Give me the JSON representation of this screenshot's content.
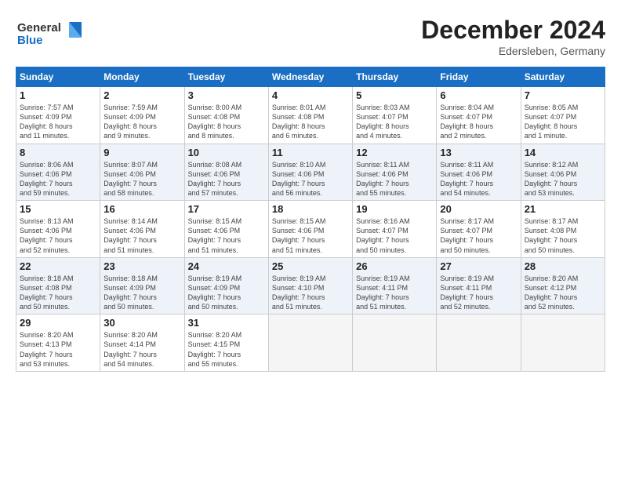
{
  "header": {
    "logo_line1": "General",
    "logo_line2": "Blue",
    "month_title": "December 2024",
    "location": "Edersleben, Germany"
  },
  "days_of_week": [
    "Sunday",
    "Monday",
    "Tuesday",
    "Wednesday",
    "Thursday",
    "Friday",
    "Saturday"
  ],
  "weeks": [
    {
      "row_alt": false,
      "days": [
        {
          "num": "1",
          "lines": [
            "Sunrise: 7:57 AM",
            "Sunset: 4:09 PM",
            "Daylight: 8 hours",
            "and 11 minutes."
          ]
        },
        {
          "num": "2",
          "lines": [
            "Sunrise: 7:59 AM",
            "Sunset: 4:09 PM",
            "Daylight: 8 hours",
            "and 9 minutes."
          ]
        },
        {
          "num": "3",
          "lines": [
            "Sunrise: 8:00 AM",
            "Sunset: 4:08 PM",
            "Daylight: 8 hours",
            "and 8 minutes."
          ]
        },
        {
          "num": "4",
          "lines": [
            "Sunrise: 8:01 AM",
            "Sunset: 4:08 PM",
            "Daylight: 8 hours",
            "and 6 minutes."
          ]
        },
        {
          "num": "5",
          "lines": [
            "Sunrise: 8:03 AM",
            "Sunset: 4:07 PM",
            "Daylight: 8 hours",
            "and 4 minutes."
          ]
        },
        {
          "num": "6",
          "lines": [
            "Sunrise: 8:04 AM",
            "Sunset: 4:07 PM",
            "Daylight: 8 hours",
            "and 2 minutes."
          ]
        },
        {
          "num": "7",
          "lines": [
            "Sunrise: 8:05 AM",
            "Sunset: 4:07 PM",
            "Daylight: 8 hours",
            "and 1 minute."
          ]
        }
      ]
    },
    {
      "row_alt": true,
      "days": [
        {
          "num": "8",
          "lines": [
            "Sunrise: 8:06 AM",
            "Sunset: 4:06 PM",
            "Daylight: 7 hours",
            "and 59 minutes."
          ]
        },
        {
          "num": "9",
          "lines": [
            "Sunrise: 8:07 AM",
            "Sunset: 4:06 PM",
            "Daylight: 7 hours",
            "and 58 minutes."
          ]
        },
        {
          "num": "10",
          "lines": [
            "Sunrise: 8:08 AM",
            "Sunset: 4:06 PM",
            "Daylight: 7 hours",
            "and 57 minutes."
          ]
        },
        {
          "num": "11",
          "lines": [
            "Sunrise: 8:10 AM",
            "Sunset: 4:06 PM",
            "Daylight: 7 hours",
            "and 56 minutes."
          ]
        },
        {
          "num": "12",
          "lines": [
            "Sunrise: 8:11 AM",
            "Sunset: 4:06 PM",
            "Daylight: 7 hours",
            "and 55 minutes."
          ]
        },
        {
          "num": "13",
          "lines": [
            "Sunrise: 8:11 AM",
            "Sunset: 4:06 PM",
            "Daylight: 7 hours",
            "and 54 minutes."
          ]
        },
        {
          "num": "14",
          "lines": [
            "Sunrise: 8:12 AM",
            "Sunset: 4:06 PM",
            "Daylight: 7 hours",
            "and 53 minutes."
          ]
        }
      ]
    },
    {
      "row_alt": false,
      "days": [
        {
          "num": "15",
          "lines": [
            "Sunrise: 8:13 AM",
            "Sunset: 4:06 PM",
            "Daylight: 7 hours",
            "and 52 minutes."
          ]
        },
        {
          "num": "16",
          "lines": [
            "Sunrise: 8:14 AM",
            "Sunset: 4:06 PM",
            "Daylight: 7 hours",
            "and 51 minutes."
          ]
        },
        {
          "num": "17",
          "lines": [
            "Sunrise: 8:15 AM",
            "Sunset: 4:06 PM",
            "Daylight: 7 hours",
            "and 51 minutes."
          ]
        },
        {
          "num": "18",
          "lines": [
            "Sunrise: 8:15 AM",
            "Sunset: 4:06 PM",
            "Daylight: 7 hours",
            "and 51 minutes."
          ]
        },
        {
          "num": "19",
          "lines": [
            "Sunrise: 8:16 AM",
            "Sunset: 4:07 PM",
            "Daylight: 7 hours",
            "and 50 minutes."
          ]
        },
        {
          "num": "20",
          "lines": [
            "Sunrise: 8:17 AM",
            "Sunset: 4:07 PM",
            "Daylight: 7 hours",
            "and 50 minutes."
          ]
        },
        {
          "num": "21",
          "lines": [
            "Sunrise: 8:17 AM",
            "Sunset: 4:08 PM",
            "Daylight: 7 hours",
            "and 50 minutes."
          ]
        }
      ]
    },
    {
      "row_alt": true,
      "days": [
        {
          "num": "22",
          "lines": [
            "Sunrise: 8:18 AM",
            "Sunset: 4:08 PM",
            "Daylight: 7 hours",
            "and 50 minutes."
          ]
        },
        {
          "num": "23",
          "lines": [
            "Sunrise: 8:18 AM",
            "Sunset: 4:09 PM",
            "Daylight: 7 hours",
            "and 50 minutes."
          ]
        },
        {
          "num": "24",
          "lines": [
            "Sunrise: 8:19 AM",
            "Sunset: 4:09 PM",
            "Daylight: 7 hours",
            "and 50 minutes."
          ]
        },
        {
          "num": "25",
          "lines": [
            "Sunrise: 8:19 AM",
            "Sunset: 4:10 PM",
            "Daylight: 7 hours",
            "and 51 minutes."
          ]
        },
        {
          "num": "26",
          "lines": [
            "Sunrise: 8:19 AM",
            "Sunset: 4:11 PM",
            "Daylight: 7 hours",
            "and 51 minutes."
          ]
        },
        {
          "num": "27",
          "lines": [
            "Sunrise: 8:19 AM",
            "Sunset: 4:11 PM",
            "Daylight: 7 hours",
            "and 52 minutes."
          ]
        },
        {
          "num": "28",
          "lines": [
            "Sunrise: 8:20 AM",
            "Sunset: 4:12 PM",
            "Daylight: 7 hours",
            "and 52 minutes."
          ]
        }
      ]
    },
    {
      "row_alt": false,
      "days": [
        {
          "num": "29",
          "lines": [
            "Sunrise: 8:20 AM",
            "Sunset: 4:13 PM",
            "Daylight: 7 hours",
            "and 53 minutes."
          ]
        },
        {
          "num": "30",
          "lines": [
            "Sunrise: 8:20 AM",
            "Sunset: 4:14 PM",
            "Daylight: 7 hours",
            "and 54 minutes."
          ]
        },
        {
          "num": "31",
          "lines": [
            "Sunrise: 8:20 AM",
            "Sunset: 4:15 PM",
            "Daylight: 7 hours",
            "and 55 minutes."
          ]
        },
        null,
        null,
        null,
        null
      ]
    }
  ]
}
